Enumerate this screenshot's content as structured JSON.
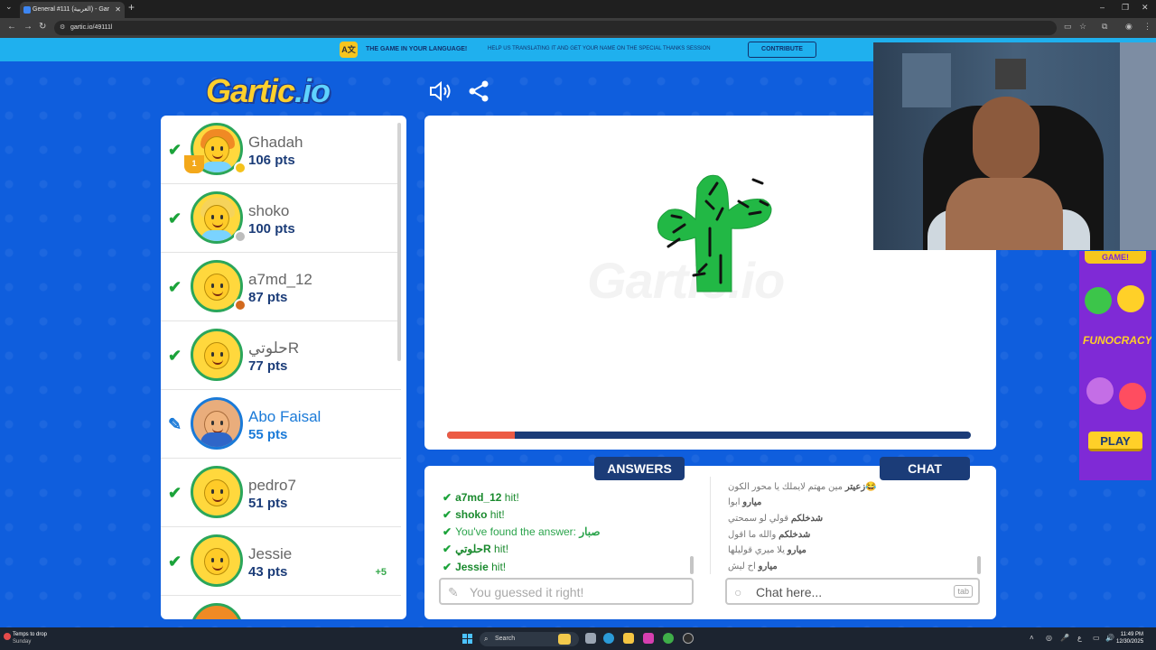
{
  "browser": {
    "tab_title": "General #111 (العربية) - Gar",
    "url": "gartic.io/49111l"
  },
  "banner": {
    "title": "THE GAME IN YOUR LANGUAGE!",
    "text": "HELP US TRANSLATING IT AND GET YOUR NAME ON THE SPECIAL THANKS SESSION",
    "button": "CONTRIBUTE"
  },
  "logo": {
    "main": "Gartic",
    "suffix": ".io"
  },
  "players": [
    {
      "name": "Ghadah",
      "pts": "106 pts",
      "status": "check",
      "dot": "#f5c21b",
      "hair": "#f08a24",
      "rank": "1"
    },
    {
      "name": "shoko",
      "pts": "100 pts",
      "status": "check",
      "dot": "#bdbdbd",
      "hair": "#f6d35a"
    },
    {
      "name": "a7md_12",
      "pts": "87 pts",
      "status": "check",
      "dot": "#d2691e"
    },
    {
      "name": "حلوتيR",
      "pts": "77 pts",
      "status": "check"
    },
    {
      "name": "Abo Faisal",
      "pts": "55 pts",
      "status": "drawing"
    },
    {
      "name": "pedro7",
      "pts": "51 pts",
      "status": "check"
    },
    {
      "name": "Jessie",
      "pts": "43 pts",
      "status": "check",
      "bonus": "+5"
    }
  ],
  "canvas": {
    "watermark": "Gartic.io",
    "timer_fraction": 0.13
  },
  "answers": {
    "tab": "ANSWERS",
    "items": [
      {
        "name": "a7md_12",
        "text": "hit!"
      },
      {
        "name": "shoko",
        "text": "hit!"
      },
      {
        "found": "You've found the answer:",
        "word": "صبار"
      },
      {
        "name": "حلوتيR",
        "text": "hit!"
      },
      {
        "name": "Jessie",
        "text": "hit!"
      }
    ],
    "input_placeholder": "You guessed it right!"
  },
  "chat": {
    "tab": "CHAT",
    "messages": [
      {
        "name": "زعيتر",
        "text": "مين مهتم لايملك يا محور الكون😂"
      },
      {
        "name": "ميارو",
        "text": "ابوا"
      },
      {
        "name": "شدخلكم",
        "text": "قولي لو سمحتي"
      },
      {
        "name": "شدخلكم",
        "text": "والله ما اقول"
      },
      {
        "name": "ميارو",
        "text": "يلا ميري قوليلها"
      },
      {
        "name": "ميارو",
        "text": "اح ليش"
      }
    ],
    "input_placeholder": "Chat here...",
    "tab_key": "tab"
  },
  "ad": {
    "top": "GAME!",
    "middle": "FUNOCRACY",
    "button": "PLAY"
  },
  "taskbar": {
    "weather_title": "Temps to drop",
    "weather_sub": "Sunday",
    "search": "Search",
    "time": "11:49 PM",
    "date": "12/30/2025"
  }
}
